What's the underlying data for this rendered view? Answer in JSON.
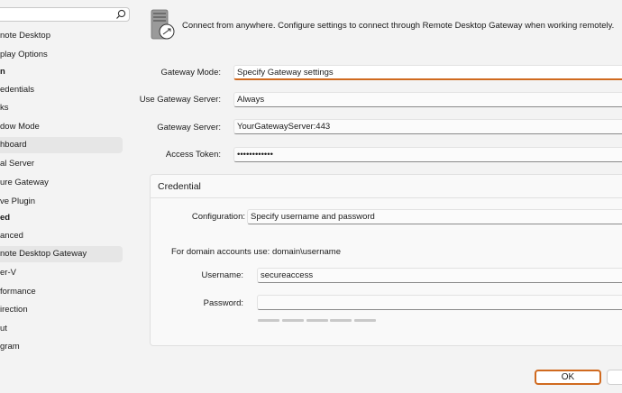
{
  "sidebar": {
    "items": [
      {
        "label": "note Desktop"
      },
      {
        "label": "play Options"
      },
      {
        "label": "n"
      },
      {
        "label": "edentials"
      },
      {
        "label": "ks"
      },
      {
        "label": "dow Mode"
      },
      {
        "label": "hboard"
      },
      {
        "label": "al Server"
      },
      {
        "label": "ure Gateway"
      },
      {
        "label": "ve Plugin"
      },
      {
        "label": "ed"
      },
      {
        "label": "anced"
      },
      {
        "label": "note Desktop Gateway"
      },
      {
        "label": "er-V"
      },
      {
        "label": "formance"
      },
      {
        "label": "irection"
      },
      {
        "label": "ut"
      },
      {
        "label": "gram"
      }
    ]
  },
  "main": {
    "intro": "Connect from anywhere. Configure settings to connect through Remote Desktop Gateway when working remotely.",
    "gateway_mode": {
      "label": "Gateway Mode:",
      "value": "Specify Gateway settings"
    },
    "use_gateway_server": {
      "label": "Use Gateway Server:",
      "value": "Always"
    },
    "gateway_server": {
      "label": "Gateway Server:",
      "value": "YourGatewayServer:443"
    },
    "access_token": {
      "label": "Access Token:",
      "value": "••••••••••••"
    },
    "credential": {
      "title": "Credential",
      "configuration": {
        "label": "Configuration:",
        "value": "Specify username and password"
      },
      "domain_note": "For domain accounts use: domain\\username",
      "username": {
        "label": "Username:",
        "value": "secureaccess"
      },
      "password": {
        "label": "Password:",
        "value": ""
      }
    }
  },
  "footer": {
    "ok_label": "OK",
    "cancel_label": ""
  },
  "colors": {
    "accent": "#d06a1f",
    "selected_bg": "#e6e6e6"
  }
}
